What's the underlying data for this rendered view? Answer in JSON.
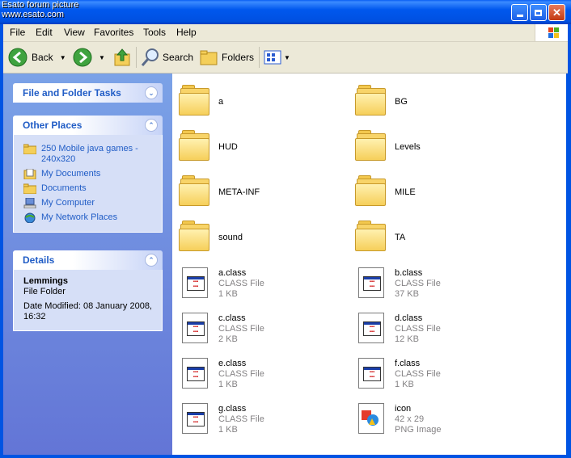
{
  "watermark": {
    "line1": "Esato forum picture",
    "line2": "www.esato.com"
  },
  "window": {
    "title": "Lemmings"
  },
  "menubar": {
    "items": [
      "File",
      "Edit",
      "View",
      "Favorites",
      "Tools",
      "Help"
    ]
  },
  "toolbar": {
    "back": "Back",
    "search": "Search",
    "folders": "Folders"
  },
  "tasks": {
    "title": "File and Folder Tasks"
  },
  "other_places": {
    "title": "Other Places",
    "items": [
      {
        "label": "250 Mobile java games - 240x320",
        "icon": "folder-icon"
      },
      {
        "label": "My Documents",
        "icon": "my-documents-icon"
      },
      {
        "label": "Documents",
        "icon": "folder-icon"
      },
      {
        "label": "My Computer",
        "icon": "my-computer-icon"
      },
      {
        "label": "My Network Places",
        "icon": "network-places-icon"
      }
    ]
  },
  "details": {
    "title": "Details",
    "name": "Lemmings",
    "type": "File Folder",
    "modified": "Date Modified: 08 January 2008, 16:32"
  },
  "files": [
    {
      "name": "a",
      "kind": "folder"
    },
    {
      "name": "BG",
      "kind": "folder"
    },
    {
      "name": "HUD",
      "kind": "folder"
    },
    {
      "name": "Levels",
      "kind": "folder"
    },
    {
      "name": "META-INF",
      "kind": "folder"
    },
    {
      "name": "MILE",
      "kind": "folder"
    },
    {
      "name": "sound",
      "kind": "folder"
    },
    {
      "name": "TA",
      "kind": "folder"
    },
    {
      "name": "a.class",
      "type": "CLASS File",
      "size": "1 KB",
      "kind": "class"
    },
    {
      "name": "b.class",
      "type": "CLASS File",
      "size": "37 KB",
      "kind": "class"
    },
    {
      "name": "c.class",
      "type": "CLASS File",
      "size": "2 KB",
      "kind": "class"
    },
    {
      "name": "d.class",
      "type": "CLASS File",
      "size": "12 KB",
      "kind": "class"
    },
    {
      "name": "e.class",
      "type": "CLASS File",
      "size": "1 KB",
      "kind": "class"
    },
    {
      "name": "f.class",
      "type": "CLASS File",
      "size": "1 KB",
      "kind": "class"
    },
    {
      "name": "g.class",
      "type": "CLASS File",
      "size": "1 KB",
      "kind": "class"
    },
    {
      "name": "icon",
      "type": "42 x 29",
      "size": "PNG Image",
      "kind": "png"
    }
  ]
}
